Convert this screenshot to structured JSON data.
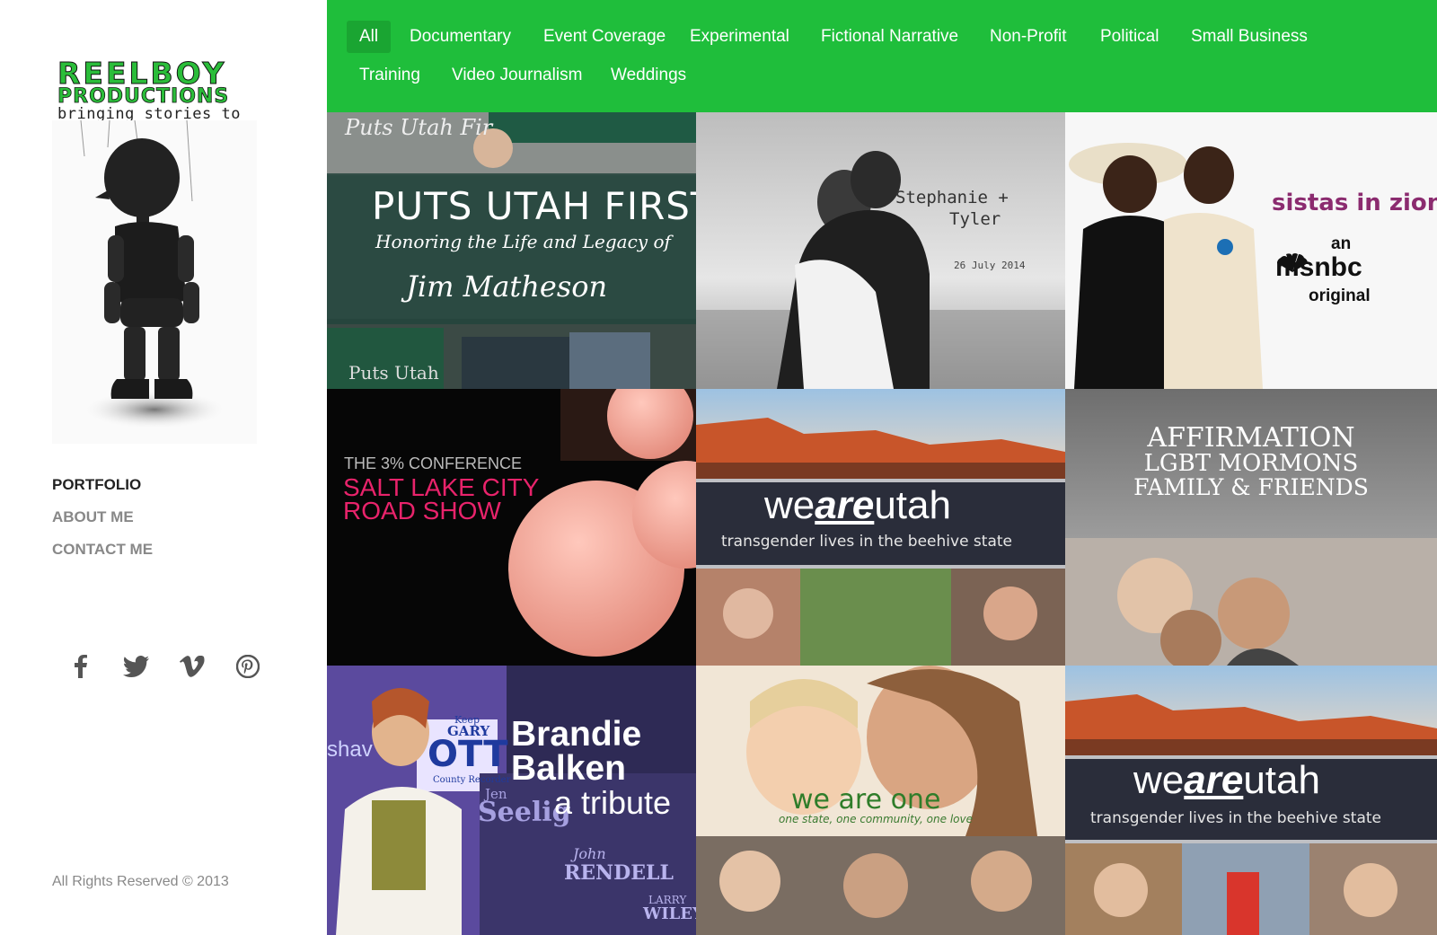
{
  "brand": {
    "line1": "REELBOY",
    "line2": "PRODUCTIONS",
    "tagline": "bringing stories to life"
  },
  "nav": {
    "items": [
      {
        "label": "PORTFOLIO",
        "active": true
      },
      {
        "label": "ABOUT ME",
        "active": false
      },
      {
        "label": "CONTACT ME",
        "active": false
      }
    ]
  },
  "social": [
    "facebook-icon",
    "twitter-icon",
    "vimeo-icon",
    "pinterest-icon"
  ],
  "footer": {
    "copyright": "All Rights Reserved © 2013"
  },
  "filters": [
    {
      "label": "All",
      "active": true
    },
    {
      "label": "Documentary"
    },
    {
      "label": "Event Coverage"
    },
    {
      "label": "Experimental"
    },
    {
      "label": "Fictional Narrative"
    },
    {
      "label": "Non-Profit"
    },
    {
      "label": "Political"
    },
    {
      "label": "Small Business"
    },
    {
      "label": "Training"
    },
    {
      "label": "Video Journalism"
    },
    {
      "label": "Weddings"
    }
  ],
  "colors": {
    "accent": "#1fbe3b",
    "accent_dark": "#1aa532",
    "brand_green": "#2bbd3a"
  },
  "tiles": {
    "t1": {
      "title": "PUTS UTAH FIRST",
      "subtitle": "Honoring the Life and Legacy of",
      "name": "Jim Matheson",
      "sign_top": "Puts Utah Fir",
      "sign_bottom": "Puts Utah"
    },
    "t2": {
      "title": "Stephanie +",
      "title2": "Tyler",
      "date": "26 July 2014"
    },
    "t3": {
      "title": "sistas in zion",
      "line1": "an",
      "line2": "msnbc",
      "line3": "original"
    },
    "t4": {
      "kicker": "THE 3% CONFERENCE",
      "title1": "SALT LAKE CITY",
      "title2": "ROAD SHOW"
    },
    "t5": {
      "we": "we",
      "are": "are",
      "utah": "utah",
      "subtitle": "transgender lives in the beehive state"
    },
    "t6": {
      "line1": "AFFIRMATION",
      "line2": "LGBT MORMONS",
      "line3": "FAMILY & FRIENDS"
    },
    "t7": {
      "line1": "Brandie",
      "line2": "Balken",
      "line3": "a tribute",
      "sign1": "Keep",
      "sign2": "GARY",
      "sign3": "OTT",
      "sign4": "County Recorder",
      "sign5": "Jen",
      "sign6": "Seelig",
      "sign7": "John",
      "sign8": "RENDELL",
      "sign9": "LARRY",
      "sign10": "WILEY",
      "sign11": "shav"
    },
    "t8": {
      "title": "we are one",
      "subtitle": "one state, one community, one love"
    },
    "t9": {
      "we": "we",
      "are": "are",
      "utah": "utah",
      "subtitle": "transgender lives in the beehive state"
    }
  }
}
